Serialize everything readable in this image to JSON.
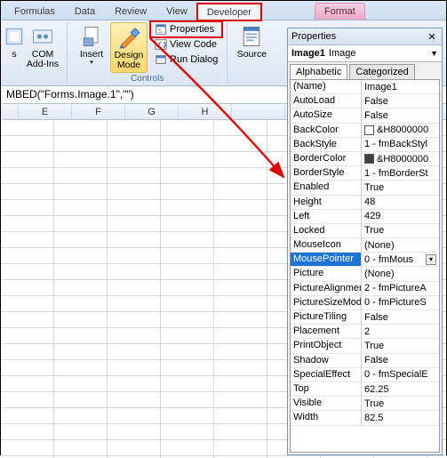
{
  "tabs": {
    "formulas": "Formulas",
    "data": "Data",
    "review": "Review",
    "view": "View",
    "developer": "Developer",
    "format": "Format"
  },
  "ribbon": {
    "addins_group_label": " ",
    "addins_s": "s",
    "addins_com1": "COM",
    "addins_com2": "Add-Ins",
    "insert": "Insert",
    "design1": "Design",
    "design2": "Mode",
    "properties": "Properties",
    "viewcode": "View Code",
    "rundialog": "Run Dialog",
    "controls_label": "Controls",
    "source": "Source"
  },
  "formula": "MBED(\"Forms.Image.1\",\"\")",
  "columns": [
    "E",
    "F",
    "G",
    "H",
    " "
  ],
  "props_title": "Properties",
  "obj_name": "Image1",
  "obj_type": "Image",
  "prop_tabs": {
    "alpha": "Alphabetic",
    "cat": "Categorized"
  },
  "props": [
    {
      "name": "(Name)",
      "value": "Image1"
    },
    {
      "name": "AutoLoad",
      "value": "False"
    },
    {
      "name": "AutoSize",
      "value": "False"
    },
    {
      "name": "BackColor",
      "value": "&H8000000",
      "swatch": "#ffffff"
    },
    {
      "name": "BackStyle",
      "value": "1 - fmBackStyl"
    },
    {
      "name": "BorderColor",
      "value": "&H8000000",
      "swatch": "#404040"
    },
    {
      "name": "BorderStyle",
      "value": "1 - fmBorderSt"
    },
    {
      "name": "Enabled",
      "value": "True"
    },
    {
      "name": "Height",
      "value": "48"
    },
    {
      "name": "Left",
      "value": "429"
    },
    {
      "name": "Locked",
      "value": "True"
    },
    {
      "name": "MouseIcon",
      "value": "(None)"
    },
    {
      "name": "MousePointer",
      "value": "0 - fmMous",
      "selected": true,
      "dropdown": true
    },
    {
      "name": "Picture",
      "value": "(None)"
    },
    {
      "name": "PictureAlignmen",
      "value": "2 - fmPictureA"
    },
    {
      "name": "PictureSizeMode",
      "value": "0 - fmPictureS"
    },
    {
      "name": "PictureTiling",
      "value": "False"
    },
    {
      "name": "Placement",
      "value": "2"
    },
    {
      "name": "PrintObject",
      "value": "True"
    },
    {
      "name": "Shadow",
      "value": "False"
    },
    {
      "name": "SpecialEffect",
      "value": "0 - fmSpecialE"
    },
    {
      "name": "Top",
      "value": "62.25"
    },
    {
      "name": "Visible",
      "value": "True"
    },
    {
      "name": "Width",
      "value": "82.5"
    }
  ]
}
